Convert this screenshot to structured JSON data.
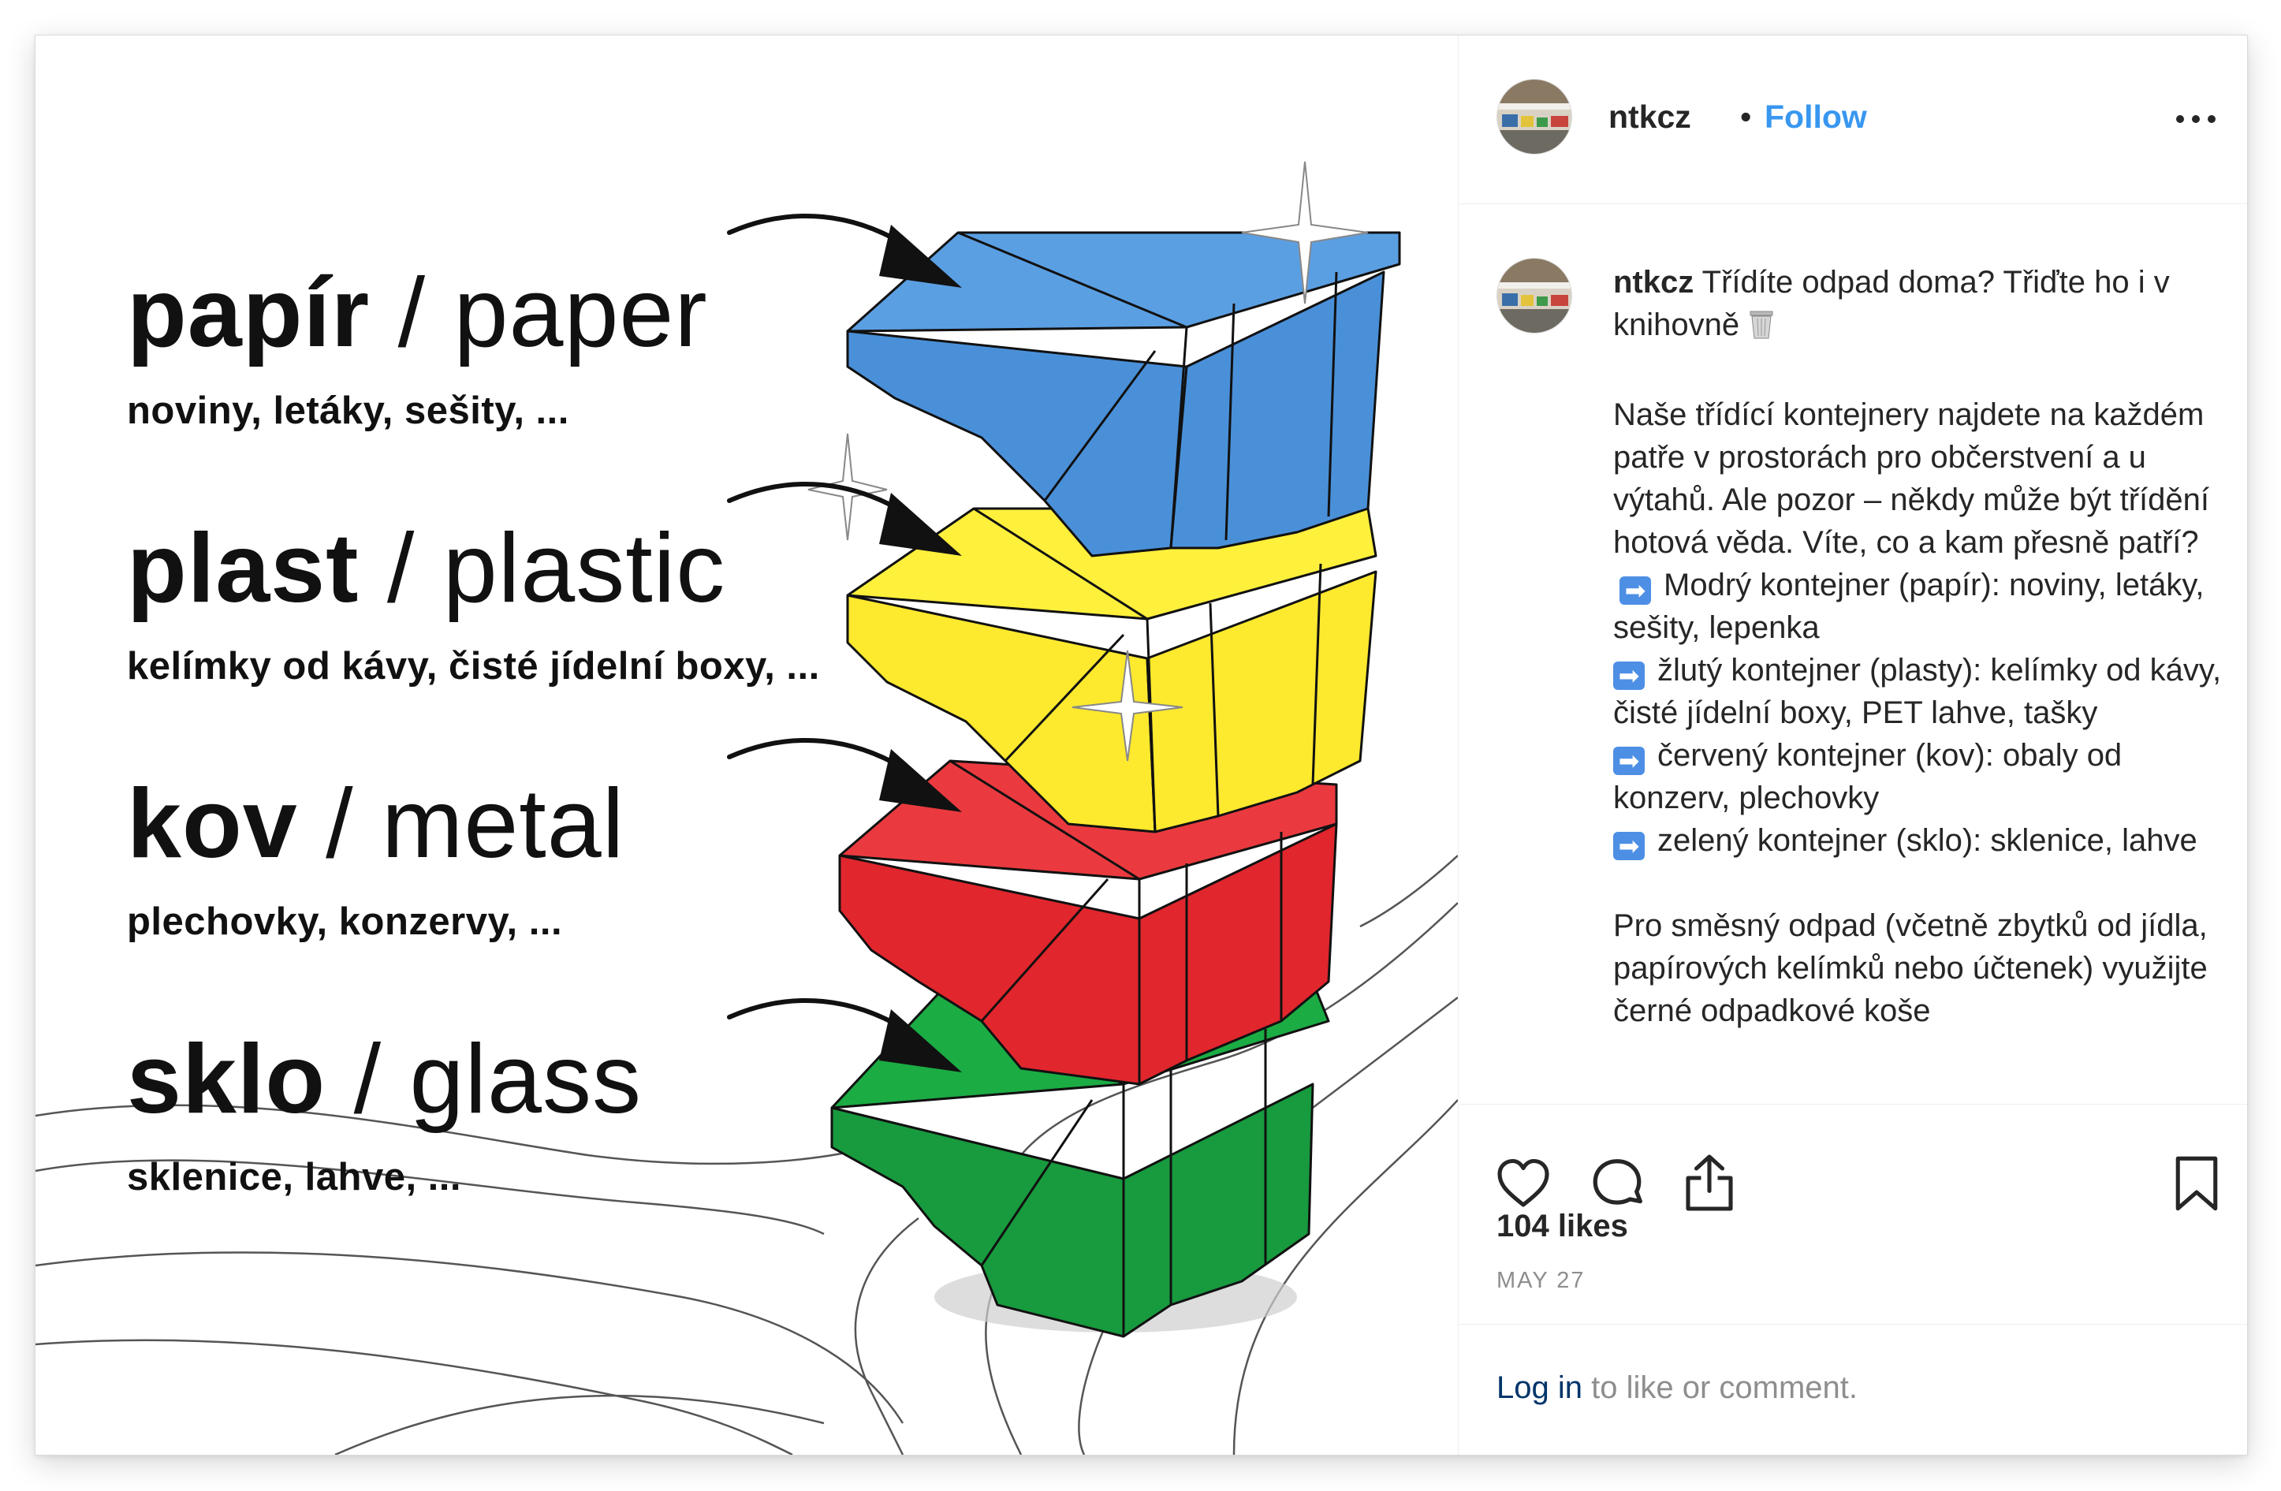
{
  "post": {
    "username": "ntkcz",
    "follow_label": "Follow",
    "separator": "•"
  },
  "poster": {
    "bins": [
      {
        "czech": "papír",
        "english": "paper",
        "items": "noviny, letáky, sešity, ...",
        "color": "#4a90d9"
      },
      {
        "czech": "plast",
        "english": "plastic",
        "items": "kelímky od kávy, čisté jídelní boxy, ...",
        "color": "#fde92e"
      },
      {
        "czech": "kov",
        "english": "metal",
        "items": "plechovky, konzervy, ...",
        "color": "#e1262d"
      },
      {
        "czech": "sklo",
        "english": "glass",
        "items": "sklenice, lahve, ...",
        "color": "#189a3e"
      }
    ],
    "slash": "/"
  },
  "caption": {
    "username": "ntkcz",
    "intro": "Třídíte odpad doma? Třiďte ho i v knihovně",
    "paragraph": "Naše třídící kontejnery najdete na každém patře v prostorách pro občerstvení a u výtahů. Ale pozor – někdy může být třídění hotová věda. Víte, co a kam přesně patří?",
    "line_blue": "Modrý kontejner (papír): noviny, letáky, sešity, lepenka",
    "line_yellow": "žlutý kontejner (plasty): kelímky od kávy, čisté jídelní boxy, PET lahve, tašky",
    "line_red": "červený kontejner (kov): obaly od konzerv, plechovky",
    "line_green": "zelený kontejner (sklo): sklenice, lahve",
    "mixed": "Pro směsný odpad (včetně zbytků od jídla, papírových kelímků nebo účtenek) využijte černé odpadkové koše"
  },
  "icons": {
    "more": "more-horizontal-icon",
    "like": "heart-icon",
    "comment": "comment-icon",
    "share": "share-icon",
    "save": "bookmark-icon",
    "arrow_emoji": "right-arrow-emoji-icon",
    "bin_emoji": "wastebasket-emoji-icon"
  },
  "stats": {
    "likes": "104 likes",
    "date": "MAY 27"
  },
  "login": {
    "link": "Log in",
    "rest": " to like or comment."
  },
  "colors": {
    "link_blue": "#3897f0",
    "login_link": "#003569",
    "muted": "#8e8e8e",
    "text": "#262626"
  }
}
